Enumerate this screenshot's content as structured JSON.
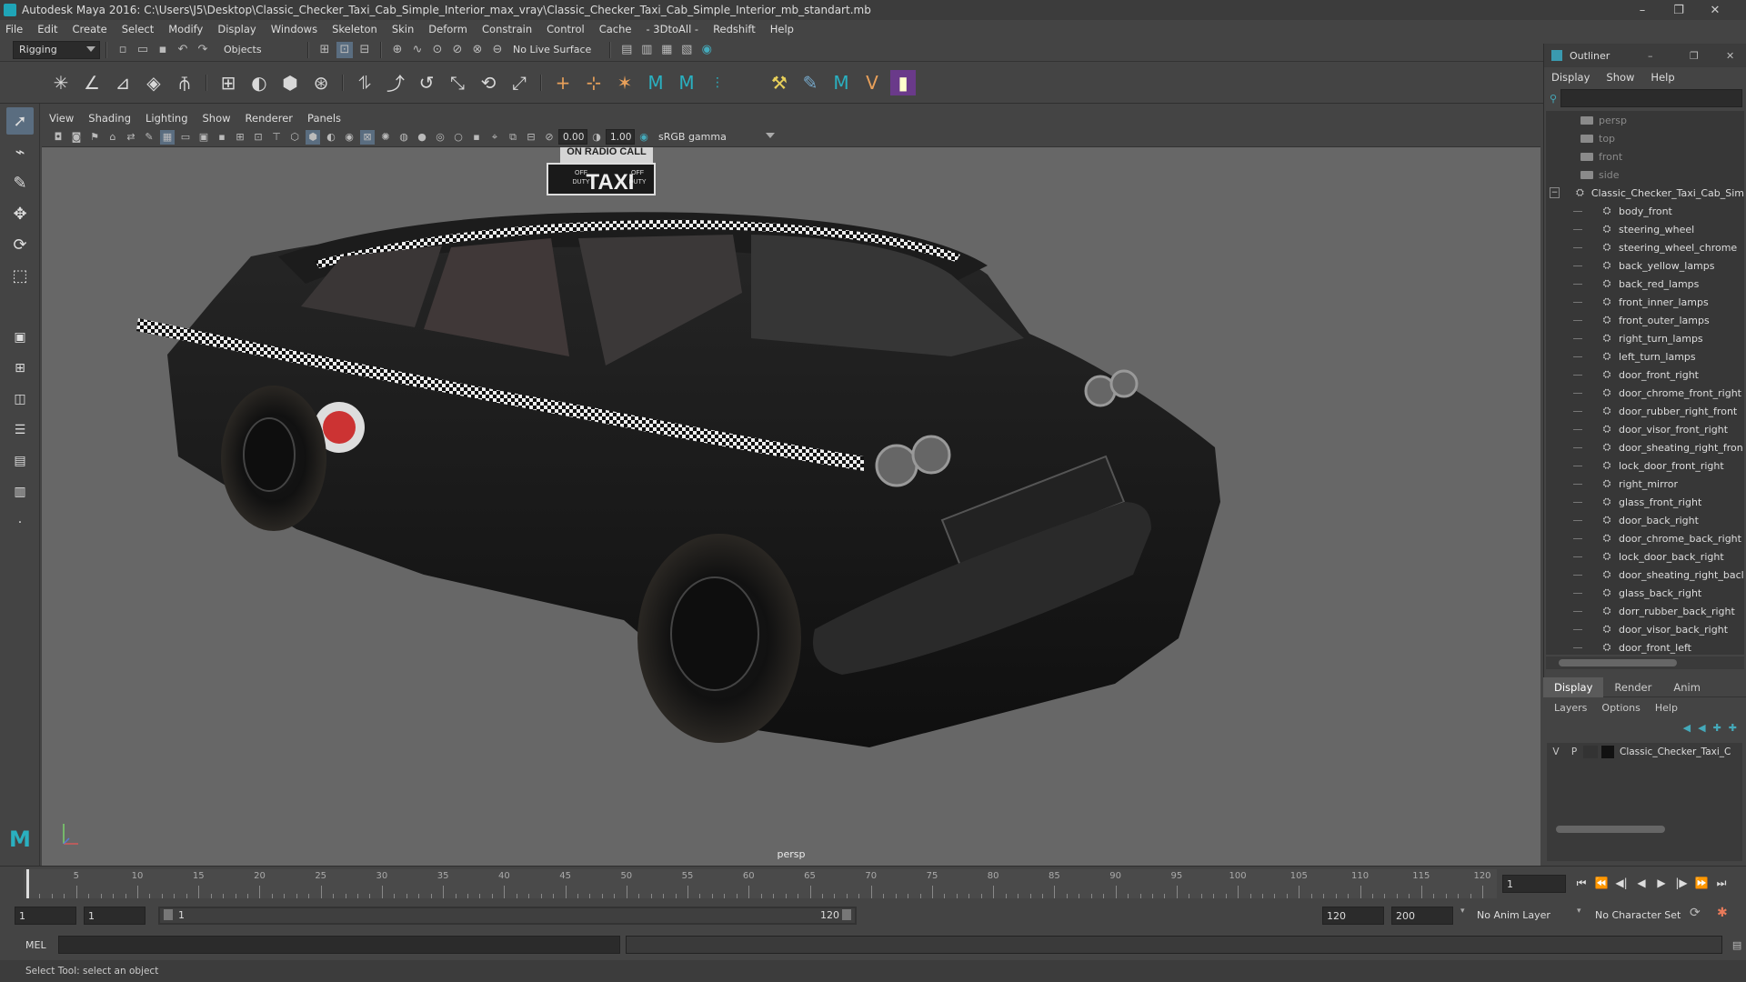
{
  "window": {
    "title": "Autodesk Maya 2016: C:\\Users\\J5\\Desktop\\Classic_Checker_Taxi_Cab_Simple_Interior_max_vray\\Classic_Checker_Taxi_Cab_Simple_Interior_mb_standart.mb",
    "minimize": "–",
    "maximize": "❐",
    "close": "✕"
  },
  "menubar": [
    "File",
    "Edit",
    "Create",
    "Select",
    "Modify",
    "Display",
    "Windows",
    "Skeleton",
    "Skin",
    "Deform",
    "Constrain",
    "Control",
    "Cache",
    "- 3DtoAll -",
    "Redshift",
    "Help"
  ],
  "statusline": {
    "menuset": "Rigging",
    "selection_mode": "Objects",
    "live_surface": "No Live Surface"
  },
  "viewport": {
    "menu": [
      "View",
      "Shading",
      "Lighting",
      "Show",
      "Renderer",
      "Panels"
    ],
    "exposure": "0.00",
    "gamma": "1.00",
    "color_space": "sRGB gamma",
    "camera_label": "persp",
    "scene": {
      "sign_top": "ON RADIO CALL",
      "sign_main": "TAXI",
      "sign_left": "OFF DUTY",
      "sign_right": "OFF DUTY",
      "sign_left_1": "OFF",
      "sign_left_2": "DUTY",
      "sign_right_1": "OFF",
      "sign_right_2": "DUTY"
    }
  },
  "outliner": {
    "title": "Outliner",
    "menu": [
      "Display",
      "Show",
      "Help"
    ],
    "cameras": [
      "persp",
      "top",
      "front",
      "side"
    ],
    "root": "Classic_Checker_Taxi_Cab_Sim",
    "children": [
      "body_front",
      "steering_wheel",
      "steering_wheel_chrome",
      "back_yellow_lamps",
      "back_red_lamps",
      "front_inner_lamps",
      "front_outer_lamps",
      "right_turn_lamps",
      "left_turn_lamps",
      "door_front_right",
      "door_chrome_front_right",
      "door_rubber_right_front",
      "door_visor_front_right",
      "door_sheating_right_fron",
      "lock_door_front_right",
      "right_mirror",
      "glass_front_right",
      "door_back_right",
      "door_chrome_back_right",
      "lock_door_back_right",
      "door_sheating_right_bacl",
      "glass_back_right",
      "dorr_rubber_back_right",
      "door_visor_back_right",
      "door_front_left"
    ]
  },
  "layers": {
    "tabs": [
      "Display",
      "Render",
      "Anim"
    ],
    "menu": [
      "Layers",
      "Options",
      "Help"
    ],
    "row": {
      "v": "V",
      "p": "P",
      "name": "Classic_Checker_Taxi_C"
    }
  },
  "timeline": {
    "ticks": [
      "5",
      "10",
      "15",
      "20",
      "25",
      "30",
      "35",
      "40",
      "45",
      "50",
      "55",
      "60",
      "65",
      "70",
      "75",
      "80",
      "85",
      "90",
      "95",
      "100",
      "105",
      "110",
      "115",
      "120"
    ],
    "current_frame": "1",
    "range_start": "1",
    "playback_start": "1",
    "range_slider_start": "1",
    "range_slider_end": "120",
    "playback_end": "120",
    "range_end": "200",
    "anim_layer": "No Anim Layer",
    "character_set": "No Character Set"
  },
  "cmdline": {
    "lang": "MEL"
  },
  "helpline": "Select Tool: select an object"
}
